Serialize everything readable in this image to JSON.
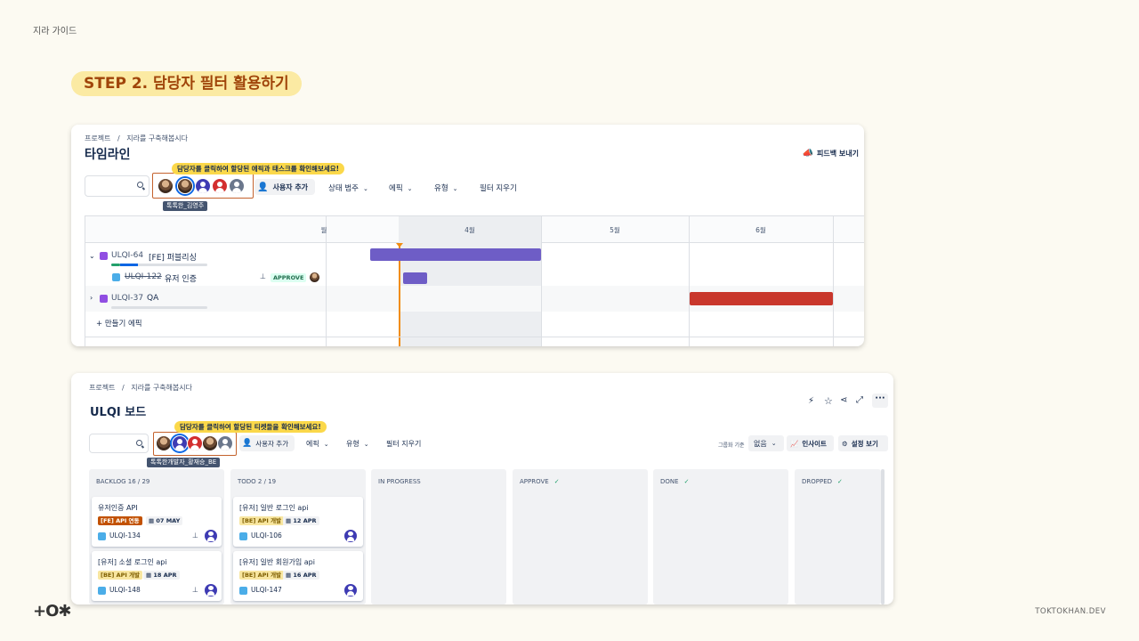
{
  "doc_label": "지라 가이드",
  "step_title": "STEP 2. 담당자 필터 활용하기",
  "footer": {
    "logo": "+O✱",
    "site": "TOKTOKHAN.DEV"
  },
  "timeline": {
    "breadcrumb_project": "프로젝트",
    "breadcrumb_sep": "/",
    "breadcrumb_space": "지라를 구축해봅시다",
    "title": "타임라인",
    "feedback": "피드백 보내기",
    "tip": "담당자를 클릭하여 할당된 에픽과 태스크를 확인해보세요!",
    "hover_name": "톡톡한_김영주",
    "add_user": "사용자 추가",
    "filters": [
      "상태 범주",
      "에픽",
      "유형"
    ],
    "clear": "필터 지우기",
    "months": [
      "월",
      "4월",
      "5월",
      "6월"
    ],
    "rows": [
      {
        "key": "ULQI-64",
        "title": "[FE] 퍼블리싱"
      },
      {
        "key": "ULQI-122",
        "title": "유저 인증",
        "status": "APPROVE"
      },
      {
        "key": "ULQI-37",
        "title": "QA"
      }
    ],
    "create_epic": "+ 만들기 에픽",
    "colors": {
      "epic_bar": "#6e5dc6",
      "qa_bar": "#c9372c",
      "today": "#f18d13"
    }
  },
  "board": {
    "breadcrumb_project": "프로젝트",
    "breadcrumb_sep": "/",
    "breadcrumb_space": "지라를 구축해봅시다",
    "title": "ULQI 보드",
    "tip": "담당자를 클릭하여 할당된 티켓들을 확인해보세요!",
    "hover_name": "톡톡한개발자_황재승_BE",
    "add_user": "사용자 추가",
    "filters": [
      "에픽",
      "유형"
    ],
    "clear": "필터 지우기",
    "group_label": "그룹화 기준",
    "group_value": "없음",
    "insight": "인사이트",
    "view_settings": "설정 보기",
    "columns": [
      {
        "name": "BACKLOG 16 / 29"
      },
      {
        "name": "TODO 2 / 19"
      },
      {
        "name": "IN PROGRESS"
      },
      {
        "name": "APPROVE",
        "check": "✓"
      },
      {
        "name": "DONE",
        "check": "✓"
      },
      {
        "name": "DROPPED",
        "check": "✓"
      }
    ],
    "backlog_cards": [
      {
        "title": "유저인증 API",
        "label": "[FE] API 연동",
        "date": "07 MAY",
        "key": "ULQI-134"
      },
      {
        "title": "[유저] 소셜 로그인 api",
        "label": "[BE] API 개발",
        "date": "18 APR",
        "key": "ULQI-148"
      }
    ],
    "todo_cards": [
      {
        "title": "[유저] 일반 로그인 api",
        "label": "[BE] API 개발",
        "date": "12 APR",
        "key": "ULQI-106"
      },
      {
        "title": "[유저] 일반 회원가입 api",
        "label": "[BE] API 개발",
        "date": "16 APR",
        "key": "ULQI-147"
      }
    ]
  }
}
